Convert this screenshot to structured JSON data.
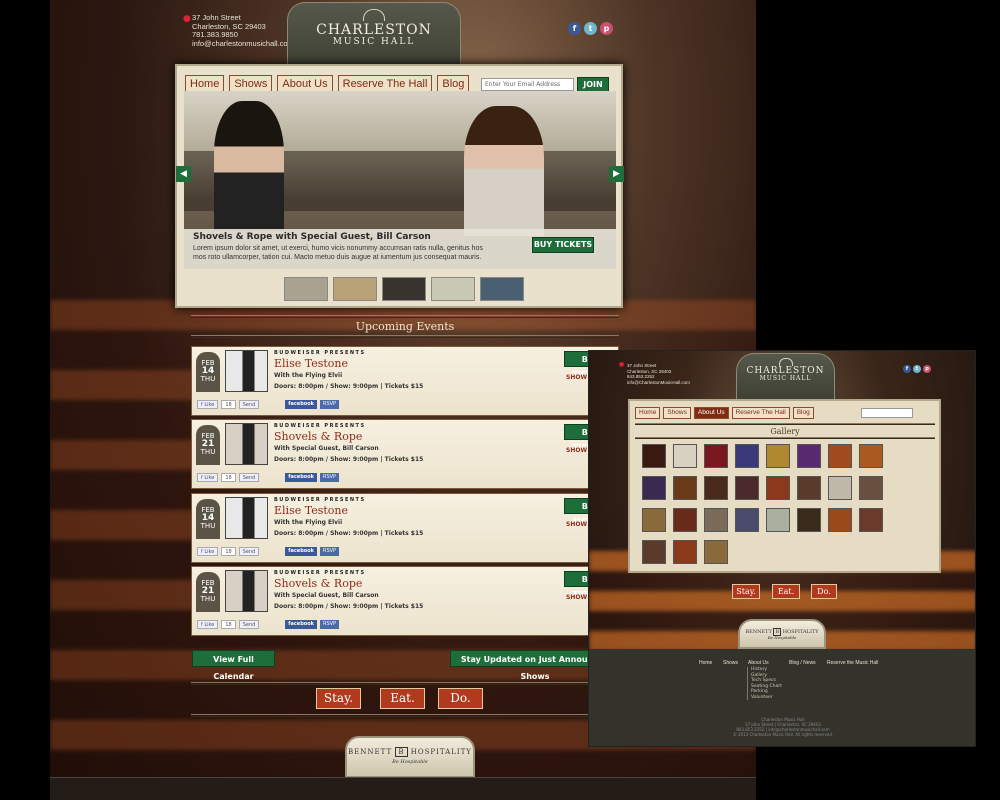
{
  "site": {
    "logo_line1": "CHARLESTON",
    "logo_line2": "MUSIC HALL",
    "address": [
      "37 John Street",
      "Charleston, SC 29403",
      "781.383.9850",
      "info@charlestonmusichall.com"
    ]
  },
  "nav": {
    "items": [
      "Home",
      "Shows",
      "About Us",
      "Reserve The Hall",
      "Blog"
    ]
  },
  "newsletter": {
    "placeholder": "Enter Your Email Address",
    "join": "JOIN"
  },
  "hero": {
    "title": "Shovels & Rope with Special Guest, Bill Carson",
    "desc": "Lorem ipsum dolor sit amet, ut exerci, humo vicis nonummy accumsan ratis nulla, genitus hos mos roto ullamcorper, tation cui. Macto metuo duis augue at iumentum jus consequat mauris.",
    "buy": "BUY TICKETS",
    "prev": "◀",
    "next": "▶"
  },
  "upcoming": {
    "title": "Upcoming Events"
  },
  "events": [
    {
      "month": "FEB",
      "day": "14",
      "dow": "THU",
      "presents": "BUDWEISER PRESENTS",
      "name": "Elise Testone",
      "sub": "With the Flying Elvii",
      "doors": "Doors: 8:00pm / Show: 9:00pm | Tickets $15",
      "buy": "BUY TICKETS",
      "info": "SHOW INFO",
      "like": "Like",
      "count": "18",
      "send": "Send",
      "fb": "facebook",
      "rsvp": "RSVP"
    },
    {
      "month": "FEB",
      "day": "21",
      "dow": "THU",
      "presents": "BUDWEISER PRESENTS",
      "name": "Shovels & Rope",
      "sub": "With Special Guest, Bill Carson",
      "doors": "Doors: 8:00pm / Show: 9:00pm | Tickets $15",
      "buy": "BUY TICKETS",
      "info": "SHOW INFO",
      "like": "Like",
      "count": "18",
      "send": "Send",
      "fb": "facebook",
      "rsvp": "RSVP"
    },
    {
      "month": "FEB",
      "day": "14",
      "dow": "THU",
      "presents": "BUDWEISER PRESENTS",
      "name": "Elise Testone",
      "sub": "With the Flying Elvii",
      "doors": "Doors: 8:00pm / Show: 9:00pm | Tickets $15",
      "buy": "BUY TICKETS",
      "info": "SHOW INFO",
      "like": "Like",
      "count": "18",
      "send": "Send",
      "fb": "facebook",
      "rsvp": "RSVP"
    },
    {
      "month": "FEB",
      "day": "21",
      "dow": "THU",
      "presents": "BUDWEISER PRESENTS",
      "name": "Shovels & Rope",
      "sub": "With Special Guest, Bill Carson",
      "doors": "Doors: 8:00pm / Show: 9:00pm | Tickets $15",
      "buy": "BUY TICKETS",
      "info": "SHOW INFO",
      "like": "Like",
      "count": "18",
      "send": "Send",
      "fb": "facebook",
      "rsvp": "RSVP"
    }
  ],
  "cta": {
    "calendar": "View Full Calendar",
    "stay_updated": "Stay Updated on Just Announced Shows"
  },
  "sed": {
    "stay": "Stay.",
    "eat": "Eat.",
    "do": "Do."
  },
  "partner": {
    "line1": "BENNETT",
    "line2": "HOSPITALITY",
    "tag": "Be Hospitable"
  },
  "second": {
    "address": [
      "37 John Street",
      "Charleston, SC 29403",
      "843.853.2252",
      "info@CharlestonMusicHall.com"
    ],
    "nav": [
      "Home",
      "Shows",
      "About Us",
      "Reserve The Hall",
      "Blog"
    ],
    "gallery_title": "Gallery",
    "footer_nav": [
      "Home",
      "Shows",
      "About Us",
      "Blog / News",
      "Reserve the Music Hall"
    ],
    "footer_sub": [
      "History",
      "Gallery",
      "Tech Specs",
      "Seating Chart",
      "Parking",
      "Volunteer"
    ],
    "footer_info": [
      "Charleston Music Hall",
      "37 John Street | Charleston, SC 29403",
      "843.853.2252 | info@charlestonmusichall.com",
      "© 2013 Charleston Music Hall. All rights reserved."
    ]
  },
  "colors": {
    "accent_green": "#1e6e3b",
    "accent_red": "#8e2a1a",
    "sed_orange": "#b03a1e"
  }
}
